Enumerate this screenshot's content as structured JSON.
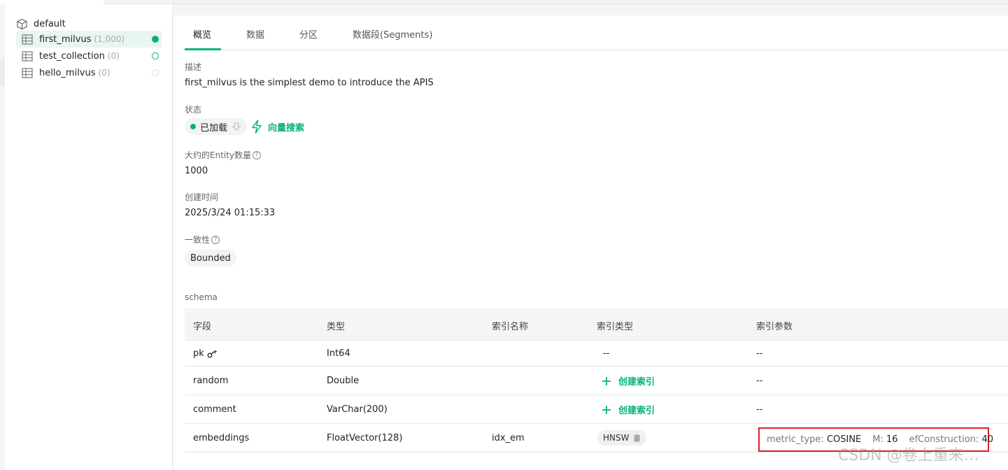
{
  "sidebar": {
    "database": "default",
    "collections": [
      {
        "name": "first_milvus",
        "count": "(1,000)",
        "status": "loaded"
      },
      {
        "name": "test_collection",
        "count": "(0)",
        "status": "loading"
      },
      {
        "name": "hello_milvus",
        "count": "(0)",
        "status": "unloaded"
      }
    ]
  },
  "tabs": [
    "概览",
    "数据",
    "分区",
    "数据段(Segments)"
  ],
  "overview": {
    "description_label": "描述",
    "description": "first_milvus is the simplest demo to introduce the APIS",
    "status_label": "状态",
    "status_value": "已加载",
    "vector_search_label": "向量搜索",
    "entity_count_label": "大约的Entity数量",
    "entity_count": "1000",
    "created_label": "创建时间",
    "created_value": "2025/3/24 01:15:33",
    "consistency_label": "一致性",
    "consistency_value": "Bounded",
    "schema_label": "schema"
  },
  "schema": {
    "headers": [
      "字段",
      "类型",
      "索引名称",
      "索引类型",
      "索引参数"
    ],
    "create_index_label": "创建索引",
    "rows": [
      {
        "field": "pk",
        "type": "Int64",
        "index_name": "",
        "index_type": "--",
        "params": "--"
      },
      {
        "field": "random",
        "type": "Double",
        "index_name": "",
        "index_type": "",
        "params": "--"
      },
      {
        "field": "comment",
        "type": "VarChar(200)",
        "index_name": "",
        "index_type": "",
        "params": "--"
      },
      {
        "field": "embeddings",
        "type": "FloatVector(128)",
        "index_name": "idx_em",
        "index_type": "HNSW",
        "params": ""
      }
    ],
    "embedding_params": {
      "metric_key": "metric_type:",
      "metric_val": "COSINE",
      "m_key": "M:",
      "m_val": "16",
      "ef_key": "efConstruction:",
      "ef_val": "40"
    }
  },
  "watermark": "CSDN @卷上重来…",
  "colors": {
    "accent": "#06b27a",
    "highlight_border": "#e02020"
  }
}
